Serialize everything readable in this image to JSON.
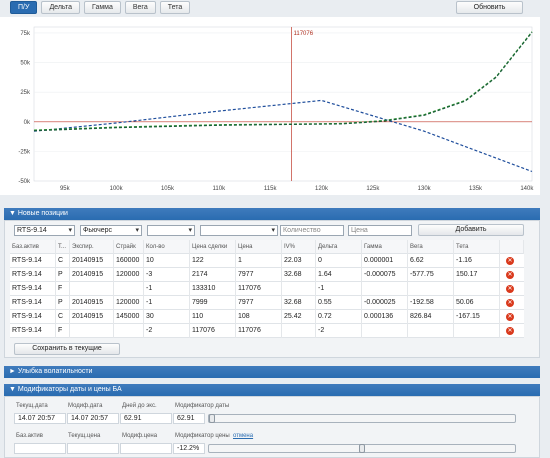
{
  "tabs": [
    "П/У",
    "Дельта",
    "Гамма",
    "Вега",
    "Тета"
  ],
  "refresh_label": "Обновить",
  "chart_data": {
    "type": "line",
    "x_ticks": [
      "95k",
      "100k",
      "105k",
      "110k",
      "115k",
      "120k",
      "125k",
      "130k",
      "135k",
      "140k"
    ],
    "y_ticks": [
      "75k",
      "50k",
      "25k",
      "0k",
      "-25k",
      "-50k"
    ],
    "xlim": [
      92000,
      140500
    ],
    "ylim": [
      -50000,
      80000
    ],
    "marker": {
      "x": 117076,
      "label": "117076"
    },
    "series": [
      {
        "color": "#1f4e9c",
        "points": [
          [
            92000,
            -8000
          ],
          [
            100000,
            -1000
          ],
          [
            110000,
            9000
          ],
          [
            120000,
            18000
          ],
          [
            130000,
            -8000
          ],
          [
            140500,
            -42000
          ]
        ]
      },
      {
        "color": "#2e9a2e",
        "points": [
          [
            92000,
            -7000
          ],
          [
            100000,
            -4500
          ],
          [
            110000,
            -2500
          ],
          [
            117000,
            -2000
          ],
          [
            122000,
            -1500
          ],
          [
            126000,
            1000
          ],
          [
            130000,
            6000
          ],
          [
            134000,
            18000
          ],
          [
            137000,
            38000
          ],
          [
            140500,
            76000
          ]
        ]
      },
      {
        "color": "#1a5c3a",
        "points": [
          [
            92000,
            -7500
          ],
          [
            100000,
            -5000
          ],
          [
            110000,
            -3000
          ],
          [
            117000,
            -2200
          ],
          [
            122000,
            -1800
          ],
          [
            126000,
            500
          ],
          [
            130000,
            5500
          ],
          [
            134000,
            17500
          ],
          [
            137000,
            37500
          ],
          [
            140500,
            75500
          ]
        ]
      }
    ]
  },
  "new_positions": {
    "header": "▼ Новые позиции",
    "form": {
      "base": "RTS-9.14",
      "type": "Фьючерс",
      "qty_placeholder": "Количество",
      "price_placeholder": "Цена",
      "add_label": "Добавить"
    },
    "columns": [
      "Баз.актив",
      "Т...",
      "Экспир.",
      "Страйк",
      "Кол-во",
      "Цена сделки",
      "Цена",
      "IV%",
      "Дельта",
      "Гамма",
      "Вега",
      "Тета"
    ],
    "rows": [
      [
        "RTS-9.14",
        "C",
        "20140915",
        "160000",
        "10",
        "122",
        "1",
        "22.03",
        "0",
        "0.000001",
        "6.62",
        "-1.16"
      ],
      [
        "RTS-9.14",
        "P",
        "20140915",
        "120000",
        "-3",
        "2174",
        "7977",
        "32.68",
        "1.64",
        "-0.000075",
        "-577.75",
        "150.17"
      ],
      [
        "RTS-9.14",
        "F",
        "",
        "",
        "-1",
        "133310",
        "117076",
        "",
        "-1",
        "",
        "",
        ""
      ],
      [
        "RTS-9.14",
        "P",
        "20140915",
        "120000",
        "-1",
        "7999",
        "7977",
        "32.68",
        "0.55",
        "-0.000025",
        "-192.58",
        "50.06"
      ],
      [
        "RTS-9.14",
        "C",
        "20140915",
        "145000",
        "30",
        "110",
        "108",
        "25.42",
        "0.72",
        "0.000136",
        "826.84",
        "-167.15"
      ],
      [
        "RTS-9.14",
        "F",
        "",
        "",
        "-2",
        "117076",
        "117076",
        "",
        "-2",
        "",
        "",
        ""
      ]
    ],
    "save_label": "Сохранить в текущие"
  },
  "smile_header": "► Улыбка волатильности",
  "modifiers": {
    "header": "▼ Модификаторы даты и цены БА",
    "labels": [
      "Текущ.дата",
      "Модиф.дата",
      "Дней до экс.",
      "Модификатор даты"
    ],
    "values": [
      "14.07 20:57",
      "14.07 20:57",
      "62.91",
      "62.91"
    ],
    "labels2": [
      "Баз.актив",
      "Текущ.цена",
      "Модиф.цена",
      "Модификатор цены"
    ],
    "cancel_link": "отмена",
    "price_modifier": "-12.2%",
    "date_slider": 0.0,
    "price_slider": 0.5
  }
}
